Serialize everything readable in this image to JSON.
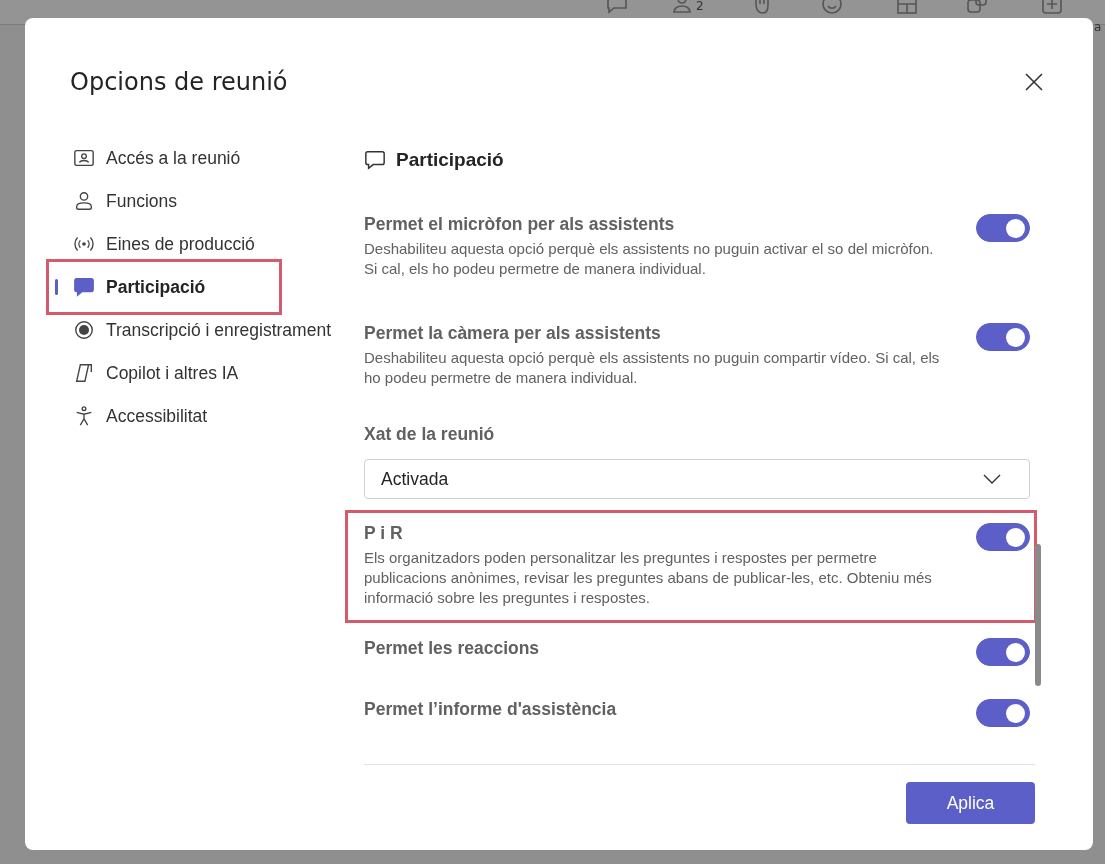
{
  "background_toolbar": {
    "participant_count": "2",
    "cut_label": "a"
  },
  "dialog": {
    "title": "Opcions de reunió"
  },
  "sidebar": {
    "items": [
      {
        "label": "Accés a la reunió",
        "selected": false,
        "highlighted": false
      },
      {
        "label": "Funcions",
        "selected": false,
        "highlighted": false
      },
      {
        "label": "Eines de producció",
        "selected": false,
        "highlighted": false
      },
      {
        "label": "Participació",
        "selected": true,
        "highlighted": true
      },
      {
        "label": "Transcripció i enregistrament",
        "selected": false,
        "highlighted": false
      },
      {
        "label": "Copilot i altres IA",
        "selected": false,
        "highlighted": false
      },
      {
        "label": "Accessibilitat",
        "selected": false,
        "highlighted": false
      }
    ]
  },
  "section": {
    "title": "Participació"
  },
  "settings": [
    {
      "kind": "toggle",
      "title": "Permet el micròfon per als assistents",
      "description": "Deshabiliteu aquesta opció perquè els assistents no puguin activar el so del micròfon. Si cal, els ho podeu permetre de manera individual.",
      "on": true,
      "highlighted": false
    },
    {
      "kind": "toggle",
      "title": "Permet la càmera per als assistents",
      "description": "Deshabiliteu aquesta opció perquè els assistents no puguin compartir vídeo. Si cal, els ho podeu permetre de manera individual.",
      "on": true,
      "highlighted": false
    },
    {
      "kind": "dropdown",
      "title": "Xat de la reunió",
      "value": "Activada"
    },
    {
      "kind": "toggle",
      "title": "P i R",
      "description": "Els organitzadors poden personalitzar les preguntes i respostes per permetre publicacions anònimes, revisar les preguntes abans de publicar-les, etc. Obteniu més informació sobre les preguntes i respostes.",
      "on": true,
      "highlighted": true
    },
    {
      "kind": "toggle",
      "title": "Permet les reaccions",
      "on": true,
      "highlighted": false
    },
    {
      "kind": "toggle",
      "title": "Permet l’informe d'assistència",
      "on": true,
      "highlighted": false
    }
  ],
  "buttons": {
    "apply": "Aplica"
  }
}
